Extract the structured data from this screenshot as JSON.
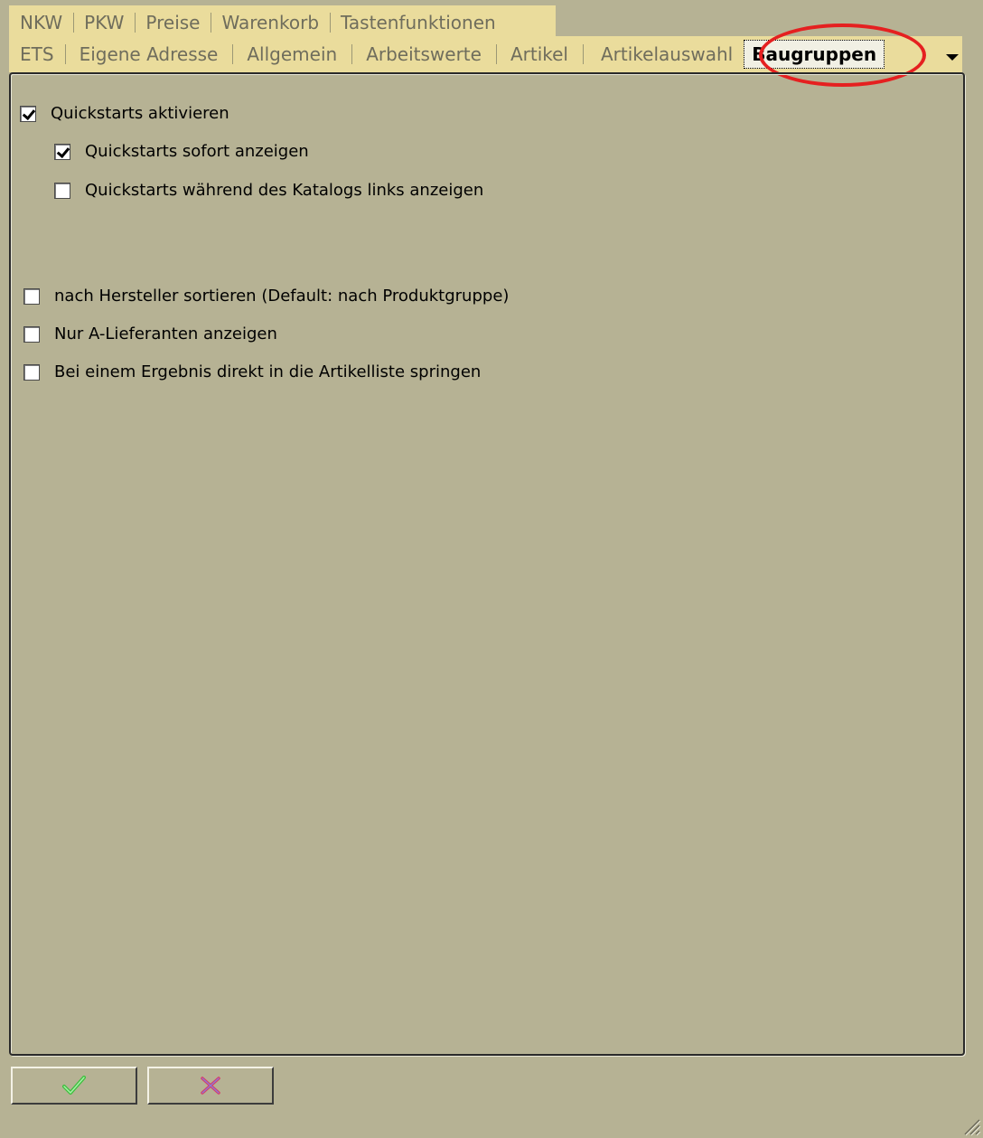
{
  "tabs_row1": [
    "NKW",
    "PKW",
    "Preise",
    "Warenkorb",
    "Tastenfunktionen"
  ],
  "tabs_row2": [
    "ETS",
    "Eigene Adresse",
    "Allgemein",
    "Arbeitswerte",
    "Artikel",
    "Artikelauswahl"
  ],
  "active_tab": "Baugruppen",
  "options": {
    "quickstarts_enable": {
      "label": "Quickstarts aktivieren",
      "checked": true
    },
    "quickstarts_immediate": {
      "label": "Quickstarts sofort anzeigen",
      "checked": true
    },
    "quickstarts_left": {
      "label": "Quickstarts während des Katalogs links anzeigen",
      "checked": false
    },
    "sort_manufacturer": {
      "label": "nach Hersteller sortieren (Default: nach Produktgruppe)",
      "checked": false
    },
    "only_a_suppliers": {
      "label": "Nur A-Lieferanten anzeigen",
      "checked": false
    },
    "jump_to_list": {
      "label": "Bei einem Ergebnis direkt in die Artikelliste springen",
      "checked": false
    }
  },
  "icons": {
    "ok": "green-checkmark-icon",
    "cancel": "red-x-icon",
    "more_tabs": "dropdown-arrow-icon",
    "resize": "resize-grip-icon"
  },
  "colors": {
    "background": "#b6b294",
    "tab_strip": "#eadc9c",
    "highlight": "#e52020"
  }
}
